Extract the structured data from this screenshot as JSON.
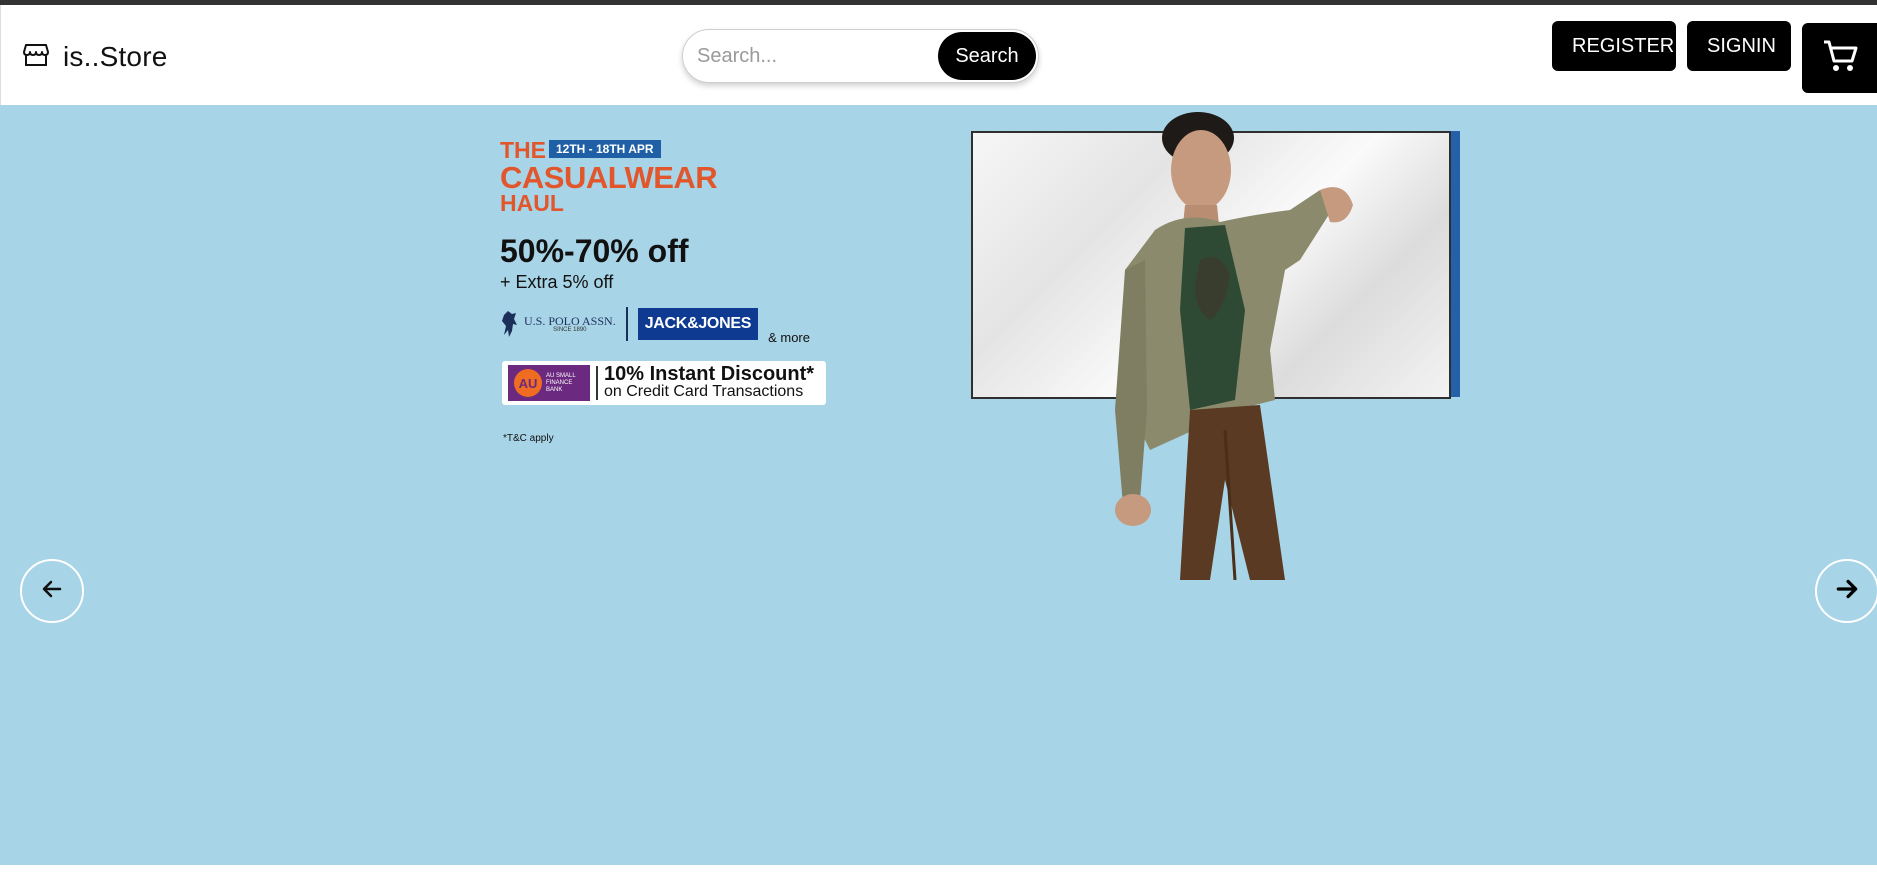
{
  "header": {
    "brand": "is..Store",
    "search_placeholder": "Search...",
    "search_button": "Search",
    "register_label": "REGISTER",
    "signin_label": "SIGNIN"
  },
  "banner": {
    "title_the": "THE",
    "title_dates": "12TH - 18TH APR",
    "title_main": "CASUALWEAR",
    "title_haul": "HAUL",
    "discount": "50%-70% off",
    "extra": "+ Extra 5% off",
    "brand1": "U.S. POLO ASSN.",
    "brand1_since": "SINCE 1890",
    "brand2": "JACK&JONES",
    "brand_more": "& more",
    "bank_short": "AU",
    "bank_name": "AU SMALL FINANCE BANK",
    "bank_offer": "10% Instant Discount*",
    "bank_offer_sub": "on Credit Card Transactions",
    "terms": "*T&C apply"
  },
  "colors": {
    "hero_bg": "#a8d4e7",
    "accent_orange": "#e2562c",
    "accent_blue": "#1f5fa6"
  },
  "icons": {
    "brand": "store-icon",
    "cart": "cart-icon",
    "prev": "arrow-left-icon",
    "next": "arrow-right-icon"
  }
}
